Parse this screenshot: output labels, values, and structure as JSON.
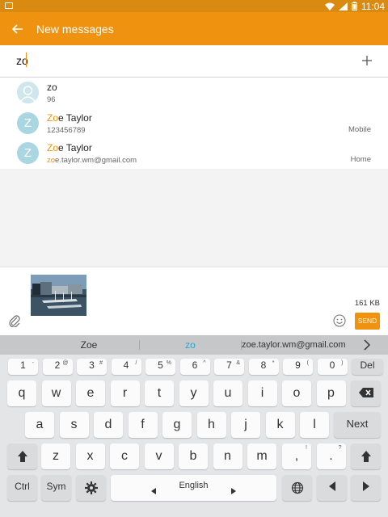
{
  "status_bar": {
    "time": "11:04"
  },
  "app_bar": {
    "title": "New messages"
  },
  "recipient": {
    "value": "zo"
  },
  "suggestions": [
    {
      "avatar": "",
      "name_match": "zo",
      "name_rest": "",
      "sub_match": "",
      "sub_rest": "96",
      "sub_accent": true,
      "type": ""
    },
    {
      "avatar": "Z",
      "name_match": "Zo",
      "name_rest": "e Taylor",
      "sub_match": "",
      "sub_rest": "123456789",
      "sub_accent": false,
      "type": "Mobile"
    },
    {
      "avatar": "Z",
      "name_match": "Zo",
      "name_rest": "e Taylor",
      "sub_match": "zo",
      "sub_rest": "e.taylor.wm@gmail.com",
      "sub_accent": false,
      "type": "Home"
    }
  ],
  "compose": {
    "attachment_size": "161 KB",
    "send_label": "SEND"
  },
  "predictions": [
    "Zoe",
    "zo",
    "zoe.taylor.wm@gmail.com"
  ],
  "colors": {
    "accent": "#ef9210",
    "status_bar": "#d98a10",
    "avatar": "#a9d6e0",
    "prediction_highlight": "#2ba6cf"
  },
  "keyboard": {
    "number_row": [
      {
        "main": "1",
        "sup": "-"
      },
      {
        "main": "2",
        "sup": "@"
      },
      {
        "main": "3",
        "sup": "#"
      },
      {
        "main": "4",
        "sup": "/"
      },
      {
        "main": "5",
        "sup": "%"
      },
      {
        "main": "6",
        "sup": "^"
      },
      {
        "main": "7",
        "sup": "&"
      },
      {
        "main": "8",
        "sup": "*"
      },
      {
        "main": "9",
        "sup": "("
      },
      {
        "main": "0",
        "sup": ")"
      },
      {
        "main": "Del",
        "sup": ""
      }
    ],
    "row1": [
      "q",
      "w",
      "e",
      "r",
      "t",
      "y",
      "u",
      "i",
      "o",
      "p"
    ],
    "row2": [
      "a",
      "s",
      "d",
      "f",
      "g",
      "h",
      "j",
      "k",
      "l"
    ],
    "row3": [
      "z",
      "x",
      "c",
      "v",
      "b",
      "n",
      "m"
    ],
    "row3_punct": [
      {
        "main": ",",
        "sup": "!"
      },
      {
        "main": ".",
        "sup": "?"
      }
    ],
    "next_label": "Next",
    "ctrl_label": "Ctrl",
    "sym_label": "Sym",
    "space_label": "English"
  },
  "icons": [
    "back-arrow-icon",
    "plus-icon",
    "paperclip-icon",
    "smiley-icon",
    "chevron-right-icon",
    "backspace-icon",
    "shift-icon",
    "settings-icon",
    "globe-icon",
    "arrow-left-icon",
    "arrow-right-icon"
  ]
}
